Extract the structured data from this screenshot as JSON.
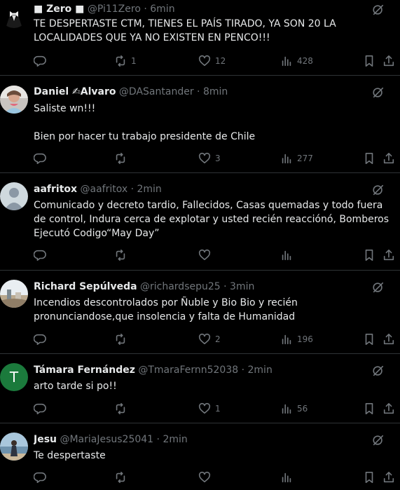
{
  "tweets": [
    {
      "name_prefix": "■ ",
      "name": "Zero",
      "name_suffix": " ■",
      "handle": "@Pi11Zero",
      "time": "6min",
      "text": "TE DESPERTASTE CTM, TIENES EL PAÍS TIRADO, YA SON 20 LA LOCALIDADES QUE YA NO EXISTEN EN PENCO!!!",
      "replies": "",
      "retweets": "1",
      "likes": "12",
      "views": "428",
      "avatar": "tuxedo"
    },
    {
      "name_prefix": "",
      "name": "Daniel ✍︎Alvaro",
      "name_suffix": "",
      "handle": "@DASantander",
      "time": "8min",
      "text": "Saliste wn!!!\n\nBien por hacer tu trabajo presidente de Chile",
      "replies": "",
      "retweets": "",
      "likes": "3",
      "views": "277",
      "avatar": "photo-person"
    },
    {
      "name_prefix": "",
      "name": "aafritox",
      "name_suffix": "",
      "handle": "@aafritox",
      "time": "2min",
      "text": "Comunicado y decreto tardio, Fallecidos, Casas quemadas y todo fuera de control, Indura cerca de explotar y usted recién reacciónó, Bomberos Ejecutó Codigo“May Day”",
      "replies": "",
      "retweets": "",
      "likes": "",
      "views": "",
      "avatar": "default"
    },
    {
      "name_prefix": "",
      "name": "Richard Sepúlveda",
      "name_suffix": "",
      "handle": "@richardsepu25",
      "time": "3min",
      "text": "Incendios descontrolados por Ñuble y Bio Bio y recién pronunciandose,que insolencia y falta de Humanidad",
      "replies": "",
      "retweets": "",
      "likes": "2",
      "views": "196",
      "avatar": "photo-landscape"
    },
    {
      "name_prefix": "",
      "name": "Támara Fernández",
      "name_suffix": "",
      "handle": "@TmaraFernn52038",
      "time": "2min",
      "text": "arto tarde si po!!",
      "replies": "",
      "retweets": "",
      "likes": "1",
      "views": "56",
      "avatar": "letter",
      "avatar_letter": "T",
      "avatar_color": "#1b7a3c"
    },
    {
      "name_prefix": "",
      "name": "Jesu",
      "name_suffix": "",
      "handle": "@MariaJesus25041",
      "time": "2min",
      "text": "Te despertaste",
      "replies": "",
      "retweets": "",
      "likes": "",
      "views": "",
      "avatar": "photo-beach"
    }
  ],
  "separator": "·",
  "colors": {
    "background": "#000000",
    "text": "#e7e9ea",
    "muted": "#71767b",
    "divider": "#2f3336"
  }
}
